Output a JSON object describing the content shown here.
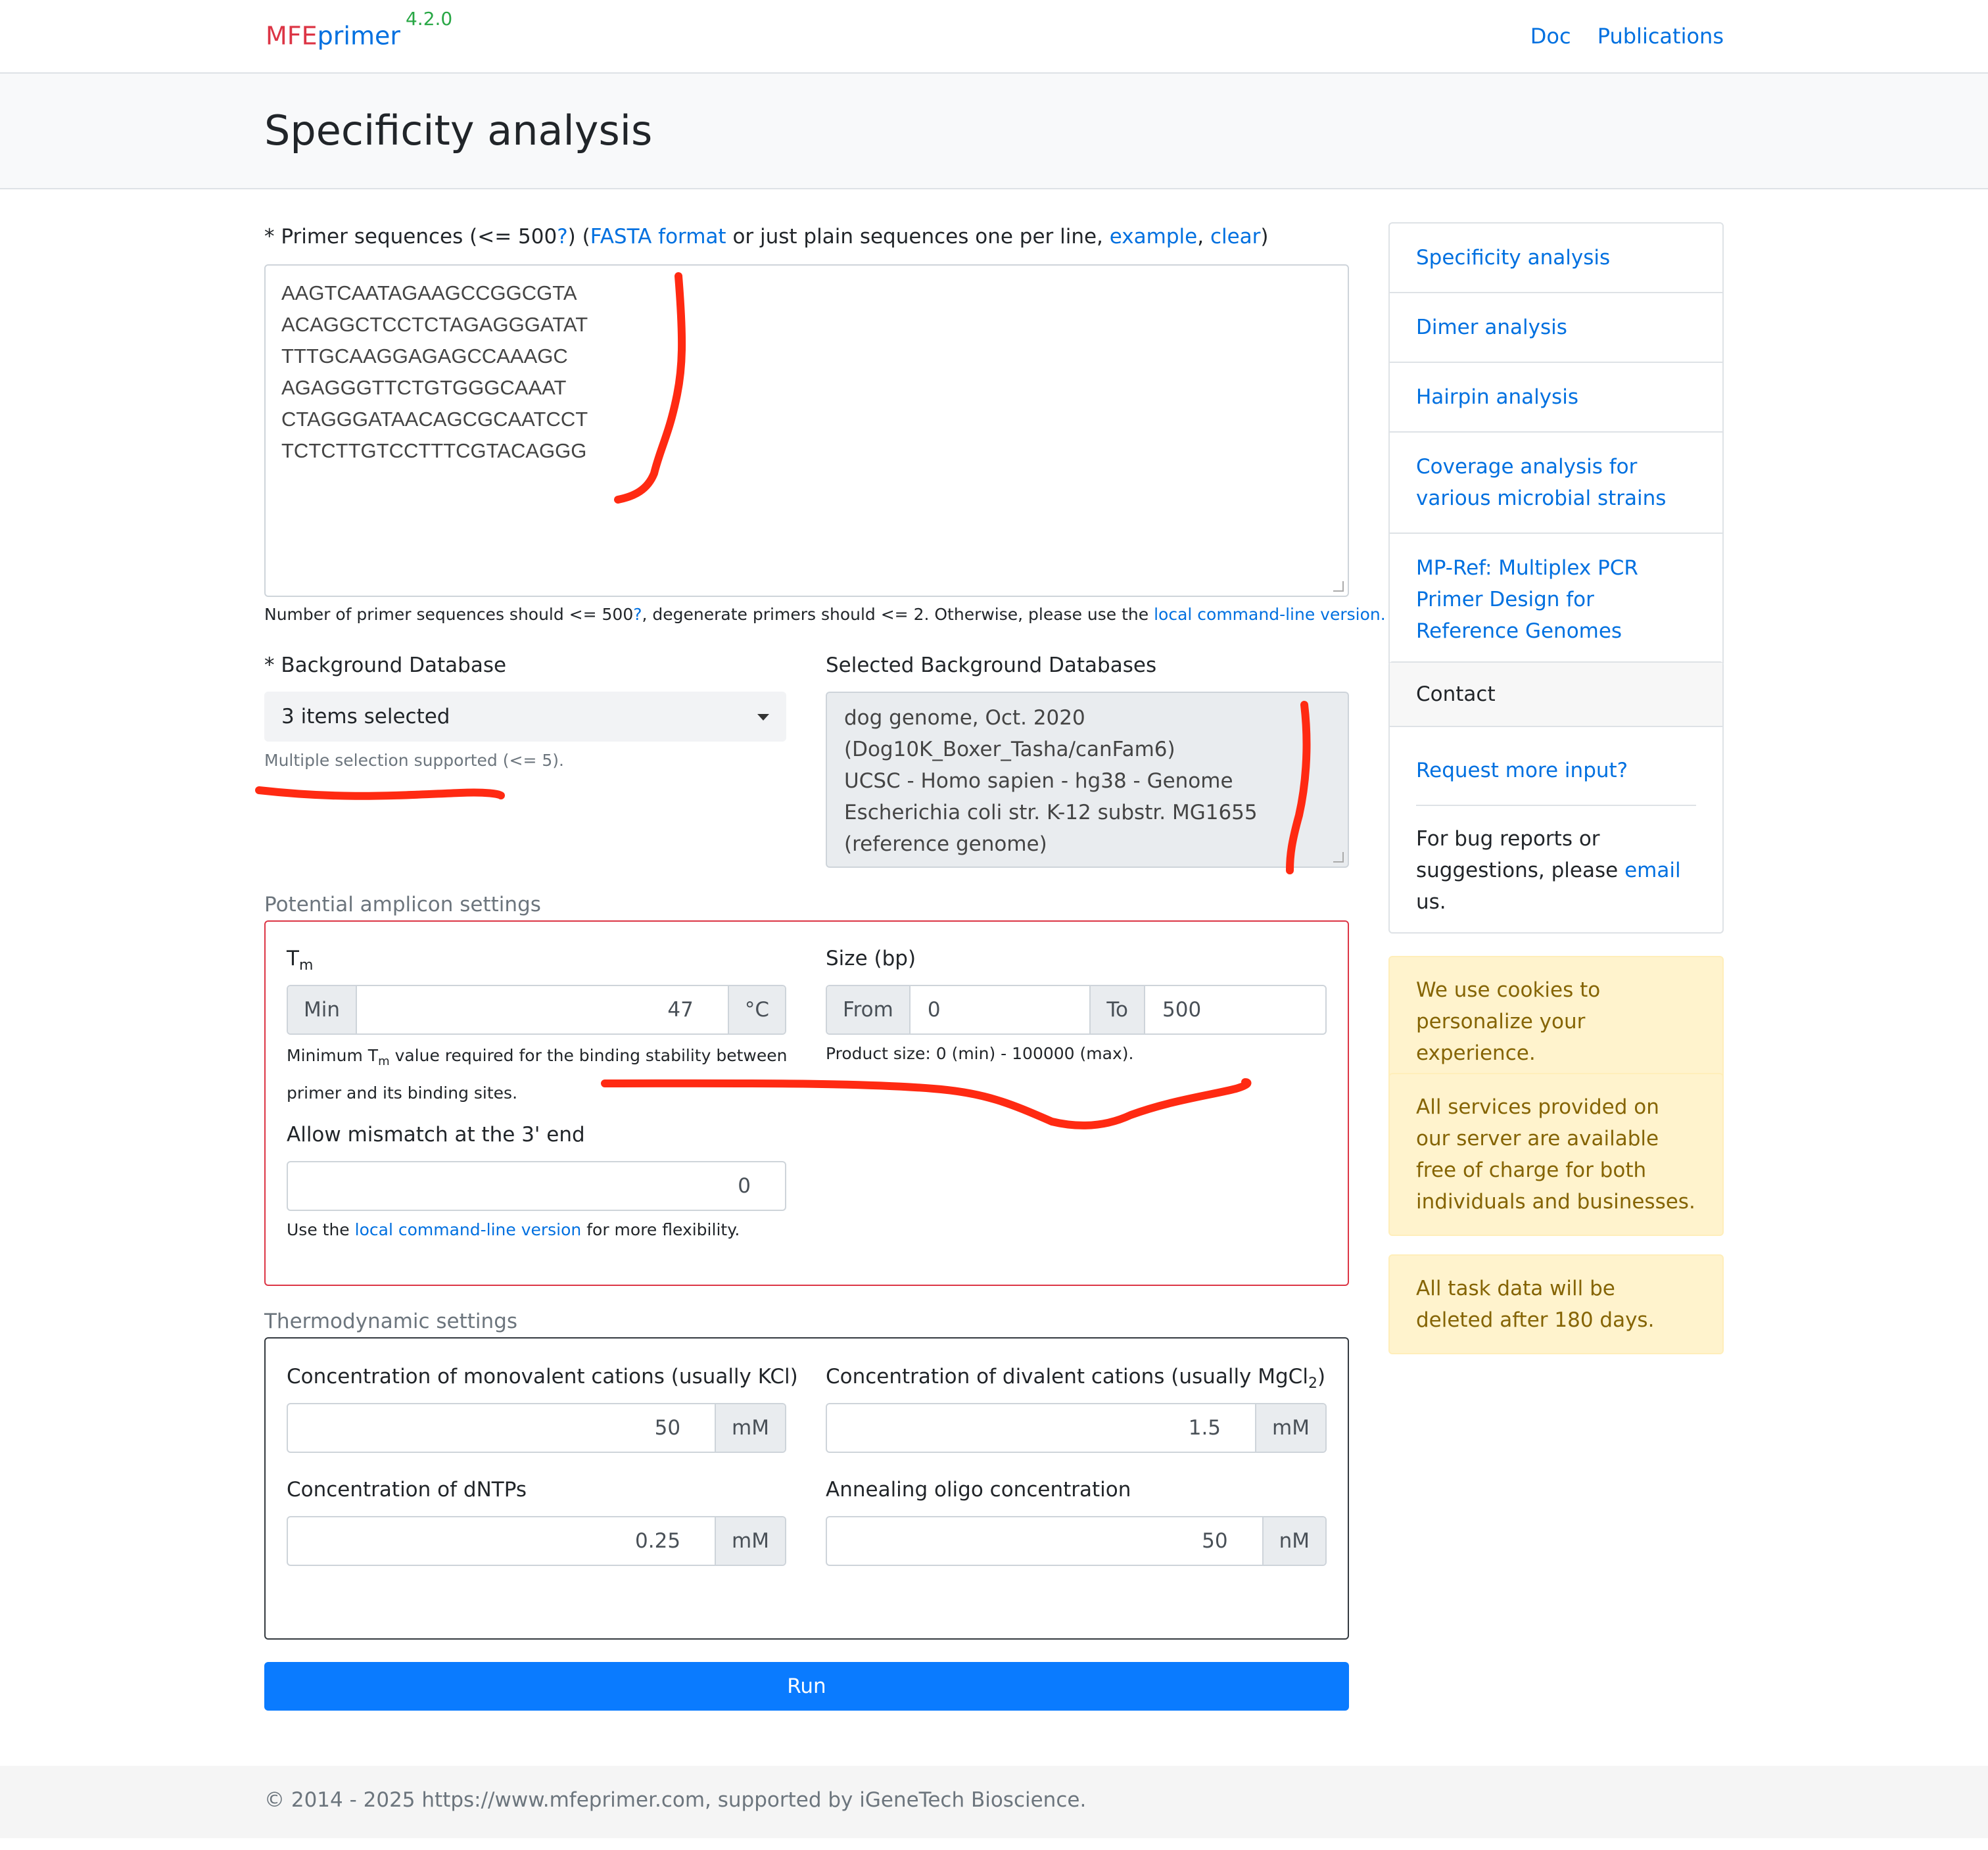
{
  "brand": {
    "mfe": "MFE",
    "primer": "primer",
    "version": "4.2.0"
  },
  "nav": {
    "doc": "Doc",
    "publications": "Publications"
  },
  "page": {
    "title": "Specificity analysis"
  },
  "primer": {
    "label_prefix": "* Primer sequences (<= 500",
    "label_q": "?",
    "label_mid1": ") (",
    "fasta_link": "FASTA format",
    "label_mid2": " or just plain sequences one per line, ",
    "example_link": "example",
    "comma": ", ",
    "clear_link": "clear",
    "label_end": ")",
    "sequences": [
      "AAGTCAATAGAAGCCGGCGTA",
      "ACAGGCTCCTCTAGAGGGATAT",
      "TTTGCAAGGAGAGCCAAAGC",
      "AGAGGGTTCTGTGGGCAAAT",
      "CTAGGGATAACAGCGCAATCCT",
      "TCTCTTGTCCTTTCGTACAGGG"
    ],
    "help_prefix": "Number of primer sequences should <= 500",
    "help_q": "?",
    "help_mid": ", degenerate primers should <= 2. Otherwise, please use the ",
    "help_link": "local command-line version."
  },
  "background_db": {
    "label": "* Background Database",
    "selected_text": "3 items selected",
    "help": "Multiple selection supported (<= 5).",
    "selected_label": "Selected Background Databases",
    "selected_lines": [
      "dog genome, Oct. 2020",
      "(Dog10K_Boxer_Tasha/canFam6)",
      "UCSC - Homo sapien - hg38 - Genome",
      "Escherichia coli str. K-12 substr. MG1655",
      "(reference genome)"
    ]
  },
  "amplicon": {
    "title": "Potential amplicon settings",
    "tm_label": "T",
    "tm_sub": "m",
    "tm_min_addon": "Min",
    "tm_value": "47",
    "tm_unit": "°C",
    "tm_help_1": "Minimum T",
    "tm_help_sub": "m",
    "tm_help_2": " value required for the binding stability between",
    "tm_help_3": "primer and its binding sites.",
    "size_label": "Size (bp)",
    "size_from_addon": "From",
    "size_from": "0",
    "size_to_addon": "To",
    "size_to": "500",
    "size_help": "Product size: 0 (min) - 100000 (max).",
    "mismatch_label": "Allow mismatch at the 3' end",
    "mismatch_value": "0",
    "mismatch_help_prefix": "Use the ",
    "mismatch_help_link": "local command-line version",
    "mismatch_help_suffix": " for more flexibility."
  },
  "thermo": {
    "title": "Thermodynamic settings",
    "mono_label": "Concentration of monovalent cations (usually KCl)",
    "mono_value": "50",
    "mono_unit": "mM",
    "di_label_1": "Concentration of divalent cations (usually MgCl",
    "di_sub": "2",
    "di_label_2": ")",
    "di_value": "1.5",
    "di_unit": "mM",
    "dntp_label": "Concentration of dNTPs",
    "dntp_value": "0.25",
    "dntp_unit": "mM",
    "oligo_label": "Annealing oligo concentration",
    "oligo_value": "50",
    "oligo_unit": "nM"
  },
  "run_label": "Run",
  "sidebar": {
    "items": [
      "Specificity analysis",
      "Dimer analysis",
      "Hairpin analysis",
      "Coverage analysis for various microbial strains",
      "MP-Ref: Multiplex PCR Primer Design for Reference Genomes"
    ]
  },
  "contact": {
    "header": "Contact",
    "request_link": "Request more input?",
    "bug_prefix": "For bug reports or suggestions, please ",
    "email_link": "email",
    "bug_suffix": " us."
  },
  "alerts": {
    "cookies": "We use cookies to personalize your experience.",
    "free": "All services provided on our server are available free of charge for both individuals and businesses.",
    "deleted": "All task data will be deleted after 180 days."
  },
  "footer": "© 2014 - 2025 https://www.mfeprimer.com, supported by iGeneTech Bioscience.",
  "colors": {
    "link": "#0070e0",
    "brand_red": "#dc3545",
    "version_green": "#28a745",
    "run_button": "#0a7bff",
    "annotation_red": "#ff2a12"
  }
}
